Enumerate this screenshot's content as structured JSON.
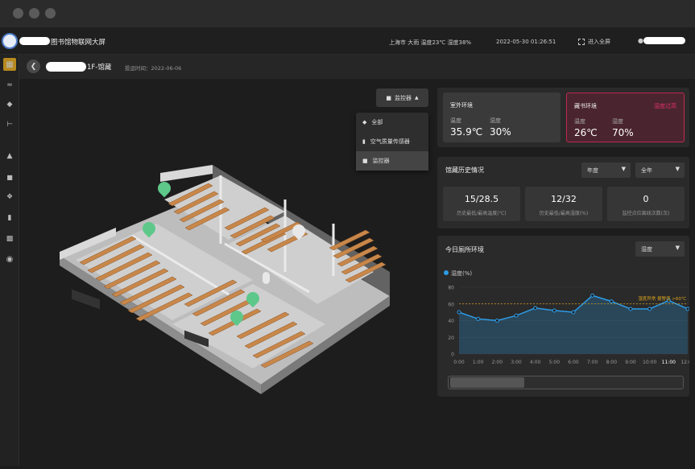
{
  "app": {
    "title": "图书馆物联网大屏",
    "location": "上海市",
    "weather": "大雨",
    "temperature": "温度23℃",
    "humidity": "湿度38%",
    "datetime": "2022-05-30 01:26:51",
    "fullscreen_label": "进入全屏"
  },
  "breadcrumb": {
    "title": "1F-馆藏",
    "date_label": "投运时间：2022-06-06"
  },
  "sidebar": {
    "icons": [
      "dashboard-icon",
      "line-chart-icon",
      "layers-icon",
      "branch-icon",
      "hierarchy-icon",
      "camera-icon",
      "network-icon",
      "lock-icon",
      "bar-chart-icon",
      "settings-icon"
    ]
  },
  "map_filter": {
    "selected": "监控器",
    "options": [
      "全部",
      "空气质量传感器",
      "监控器"
    ]
  },
  "outdoor": {
    "title": "室外环境",
    "temp_label": "温度",
    "temp_value": "35.9℃",
    "hum_label": "湿度",
    "hum_value": "30%"
  },
  "storage": {
    "title": "藏书环境",
    "alert": "湿度过高",
    "temp_label": "温度",
    "temp_value": "26℃",
    "hum_label": "湿度",
    "hum_value": "70%"
  },
  "history": {
    "title": "馆藏历史情况",
    "filter1": "年度",
    "filter2": "全年",
    "stats": [
      {
        "value": "15/28.5",
        "desc": "历史最低/最高温度(℃)"
      },
      {
        "value": "12/32",
        "desc": "历史最低/最高湿度(%)"
      },
      {
        "value": "0",
        "desc": "监控点位离线次数(次)"
      }
    ]
  },
  "today": {
    "title": "今日厕所环境",
    "filter": "湿度",
    "annotation": "湿度异常 报警值 >60℃"
  },
  "colors": {
    "accent": "#d6a21e",
    "alert": "#e0306a",
    "line": "#2d9be6",
    "threshold": "#d6a21e"
  },
  "chart_data": {
    "type": "area",
    "series": [
      {
        "name": "湿度(%)",
        "values": [
          50,
          42,
          40,
          46,
          55,
          52,
          50,
          70,
          63,
          54,
          54,
          64,
          54
        ]
      }
    ],
    "categories": [
      "0:00",
      "1:00",
      "2:00",
      "3:00",
      "4:00",
      "5:00",
      "6:00",
      "7:00",
      "8:00",
      "9:00",
      "10:00",
      "11:00",
      "12:00"
    ],
    "ylim": [
      0,
      80
    ],
    "yticks": [
      "0",
      "20",
      "40",
      "60",
      "80"
    ],
    "threshold": 60,
    "grid": true,
    "legend": "top-left"
  }
}
